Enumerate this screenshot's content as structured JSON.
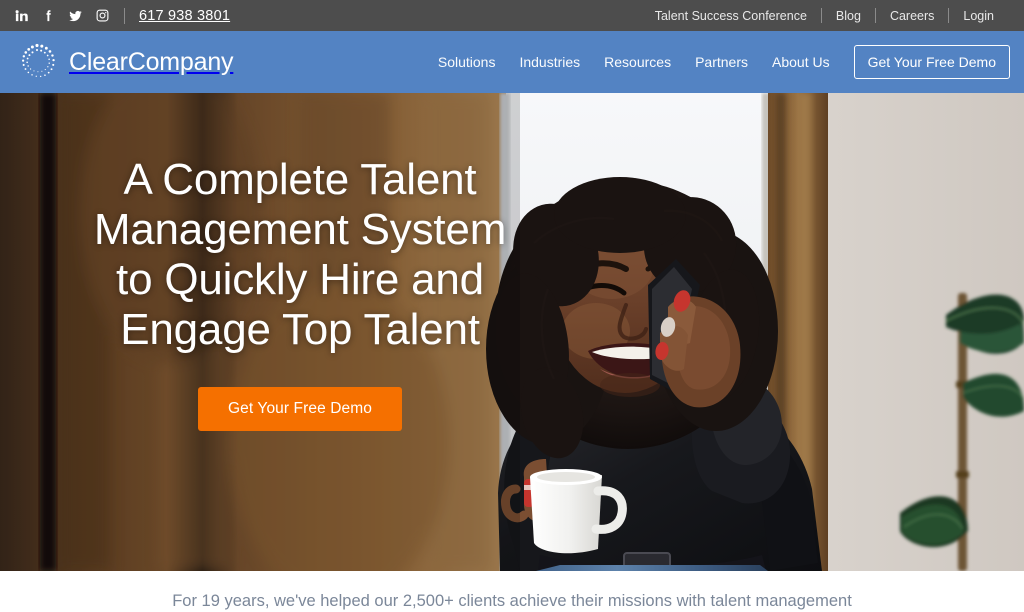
{
  "topbar": {
    "phone": "617 938 3801",
    "social": [
      {
        "name": "linkedin-icon",
        "label": "LinkedIn"
      },
      {
        "name": "facebook-icon",
        "label": "Facebook"
      },
      {
        "name": "twitter-icon",
        "label": "Twitter"
      },
      {
        "name": "instagram-icon",
        "label": "Instagram"
      }
    ],
    "links": [
      {
        "label": "Talent Success Conference"
      },
      {
        "label": "Blog"
      },
      {
        "label": "Careers"
      },
      {
        "label": "Login"
      }
    ]
  },
  "navbar": {
    "brand_name": "ClearCompany",
    "logo_icon": "clearcompany-dotted-ring-logo",
    "links": [
      {
        "label": "Solutions"
      },
      {
        "label": "Industries"
      },
      {
        "label": "Resources"
      },
      {
        "label": "Partners"
      },
      {
        "label": "About Us"
      }
    ],
    "cta_label": "Get Your Free Demo"
  },
  "hero": {
    "title": "A Complete Talent Management System to Quickly Hire and Engage Top Talent",
    "cta_label": "Get Your Free Demo",
    "image_description": "Smiling woman in black turtleneck talking on a mobile phone while holding a white coffee mug, standing by a bright window with a wooden wall and a green leafy plant"
  },
  "below_hero": {
    "text": "For 19 years, we've helped our 2,500+ clients achieve their missions with talent management"
  },
  "colors": {
    "topbar_bg": "#4d4d4d",
    "nav_blue": "#5383c3",
    "cta_orange": "#f57000",
    "below_text": "#7b8799",
    "white": "#ffffff"
  }
}
